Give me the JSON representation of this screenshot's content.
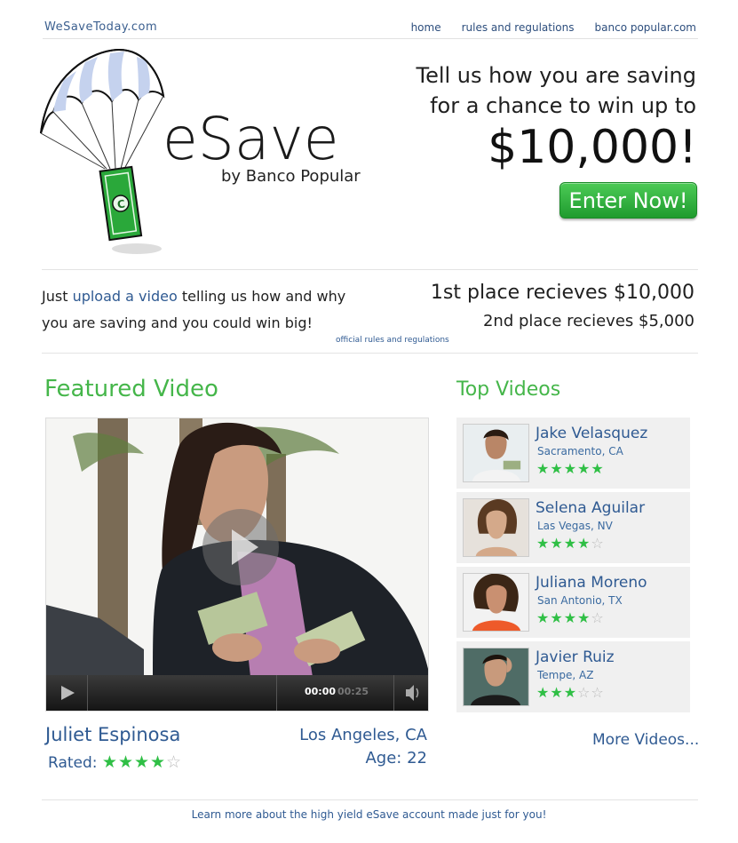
{
  "header": {
    "site_name": "WeSaveToday.com",
    "nav": [
      "home",
      "rules and regulations",
      "banco popular.com"
    ]
  },
  "brand": {
    "name": "eSave",
    "subtitle": "by Banco Popular"
  },
  "promo": {
    "line1": "Tell us how you are saving",
    "line2": "for a chance to win up to",
    "amount": "$10,000!",
    "cta": "Enter Now!"
  },
  "info": {
    "text_before": "Just ",
    "link": "upload a video",
    "text_after": " telling us how and why you are saving and you could win big!",
    "official": "official rules and regulations",
    "prize1": "1st place recieves $10,000",
    "prize2": "2nd place recieves $5,000"
  },
  "featured": {
    "title": "Featured Video",
    "time_current": "00:00",
    "time_total": "00:25",
    "name": "Juliet Espinosa",
    "rated_label": "Rated:",
    "rating": 4,
    "location": "Los Angeles, CA",
    "age": "Age: 22"
  },
  "top_videos": {
    "title": "Top Videos",
    "items": [
      {
        "name": "Jake Velasquez",
        "location": "Sacramento, CA",
        "rating": 5
      },
      {
        "name": "Selena Aguilar",
        "location": "Las Vegas, NV",
        "rating": 4
      },
      {
        "name": "Juliana Moreno",
        "location": "San Antonio, TX",
        "rating": 4
      },
      {
        "name": "Javier Ruiz",
        "location": "Tempe, AZ",
        "rating": 3
      }
    ],
    "more": "More Videos..."
  },
  "footer": {
    "link": "Learn more about the high yield eSave account made just for you!"
  },
  "colors": {
    "accent_green": "#45b64a",
    "link_blue": "#2f5a92",
    "button_green": "#2fa83c"
  },
  "icons": [
    "parachute-icon",
    "money-icon",
    "play-icon",
    "volume-icon",
    "star-icon"
  ]
}
